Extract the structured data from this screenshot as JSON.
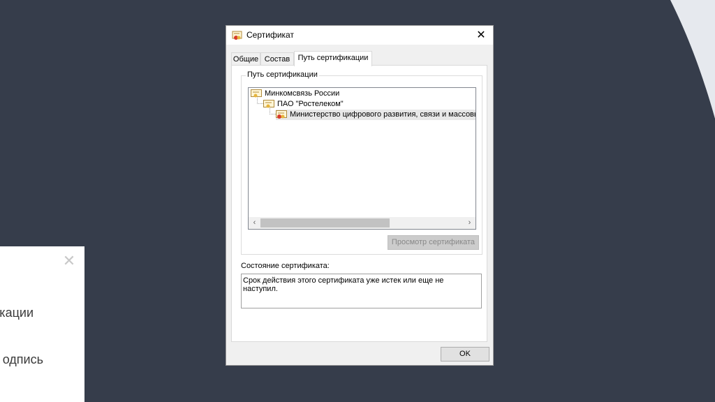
{
  "background": {
    "panel_text_1": "кации",
    "panel_text_2": "одпись"
  },
  "dialog": {
    "title": "Сертификат",
    "close_glyph": "✕",
    "tabs": [
      {
        "label": "Общие"
      },
      {
        "label": "Состав"
      },
      {
        "label": "Путь сертификации"
      }
    ],
    "path_group_label": "Путь сертификации",
    "tree": [
      {
        "label": "Минкомсвязь России"
      },
      {
        "label": "ПАО \"Ростелеком\""
      },
      {
        "label": "Министерство цифрового развития, связи и массовых"
      }
    ],
    "view_cert_button": "Просмотр сертификата",
    "status_label": "Состояние сертификата:",
    "status_text": "Срок действия этого сертификата уже истек или еще не наступил.",
    "ok_button": "OK"
  },
  "colors": {
    "background": "#363d4b",
    "curve": "#e6e9ee",
    "dialog_bg": "#f0f0f0"
  }
}
